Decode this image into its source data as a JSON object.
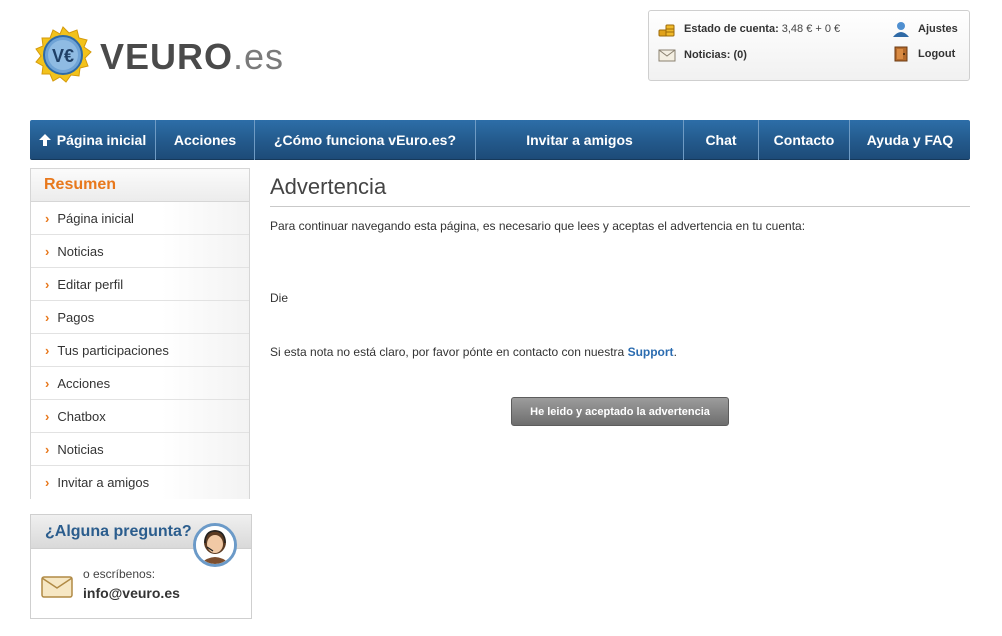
{
  "header": {
    "logo_main": "VEURO",
    "logo_suffix": ".es",
    "logo_coin_letters": "V€",
    "account": {
      "balance_label": "Estado de cuenta:",
      "balance_value": "3,48 € + 0 €",
      "news_label": "Noticias: (0)",
      "settings_label": "Ajustes",
      "logout_label": "Logout"
    }
  },
  "nav": {
    "items": [
      {
        "label": "Página inicial",
        "icon": "home-arrow-icon"
      },
      {
        "label": "Acciones"
      },
      {
        "label": "¿Cómo funciona vEuro.es?"
      },
      {
        "label": "Invitar a amigos"
      },
      {
        "label": "Chat"
      },
      {
        "label": "Contacto"
      },
      {
        "label": "Ayuda y FAQ"
      }
    ]
  },
  "sidebar": {
    "title": "Resumen",
    "items": [
      {
        "label": "Página inicial"
      },
      {
        "label": "Noticias"
      },
      {
        "label": "Editar perfil"
      },
      {
        "label": "Pagos"
      },
      {
        "label": "Tus participaciones"
      },
      {
        "label": "Acciones"
      },
      {
        "label": "Chatbox"
      },
      {
        "label": "Noticias"
      },
      {
        "label": "Invitar a amigos"
      }
    ],
    "help": {
      "title": "¿Alguna pregunta?",
      "write_label": "o escríbenos:",
      "email": "info@veuro.es"
    }
  },
  "main": {
    "title": "Advertencia",
    "intro": "Para continuar navegando esta página, es necesario que lees y aceptas el advertencia en tu cuenta:",
    "warning_text": "Die",
    "note_prefix": "Si esta nota no está claro, por favor pónte en contacto con nuestra ",
    "note_link": "Support",
    "note_suffix": ".",
    "accept_button": "He leido y aceptado la advertencia"
  },
  "colors": {
    "nav_blue": "#245b8e",
    "accent_orange": "#e8781c",
    "link_blue": "#2b6cb0"
  }
}
